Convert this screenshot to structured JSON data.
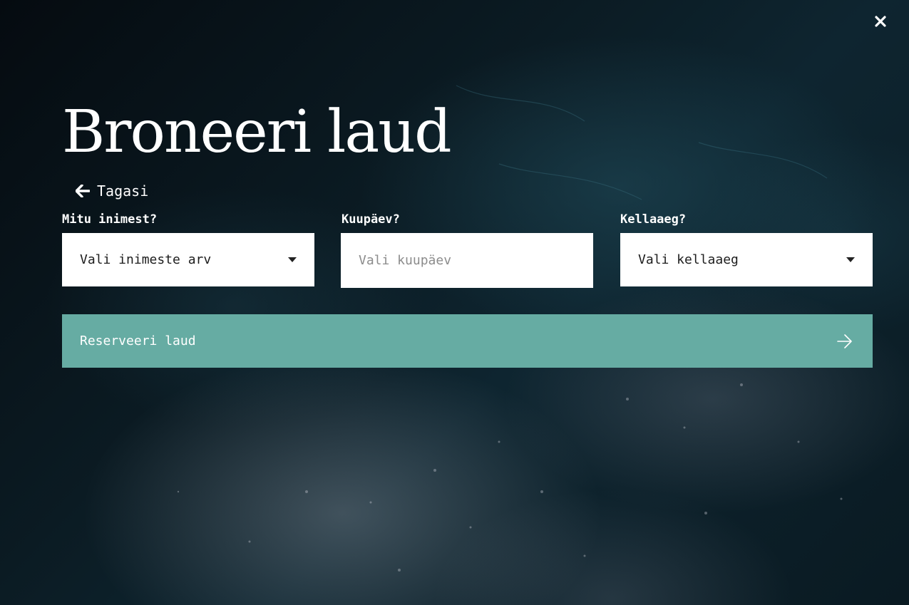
{
  "page": {
    "title": "Broneeri laud",
    "close_icon": "close-icon"
  },
  "back": {
    "label": "Tagasi",
    "icon": "arrow-left-icon"
  },
  "form": {
    "people": {
      "label": "Mitu inimest?",
      "value": "Vali inimeste arv",
      "icon": "caret-down-icon"
    },
    "date": {
      "label": "Kuupäev?",
      "placeholder": "Vali kuupäev"
    },
    "time": {
      "label": "Kellaaeg?",
      "value": "Vali kellaaeg",
      "icon": "caret-down-icon"
    },
    "submit": {
      "label": "Reserveeri laud",
      "icon": "arrow-right-icon"
    }
  },
  "colors": {
    "background": "#0b1b23",
    "accent": "#66aca3",
    "text": "#ffffff",
    "field_background": "#ffffff",
    "field_text": "#1d1d1d",
    "placeholder": "#8c8c8c"
  }
}
